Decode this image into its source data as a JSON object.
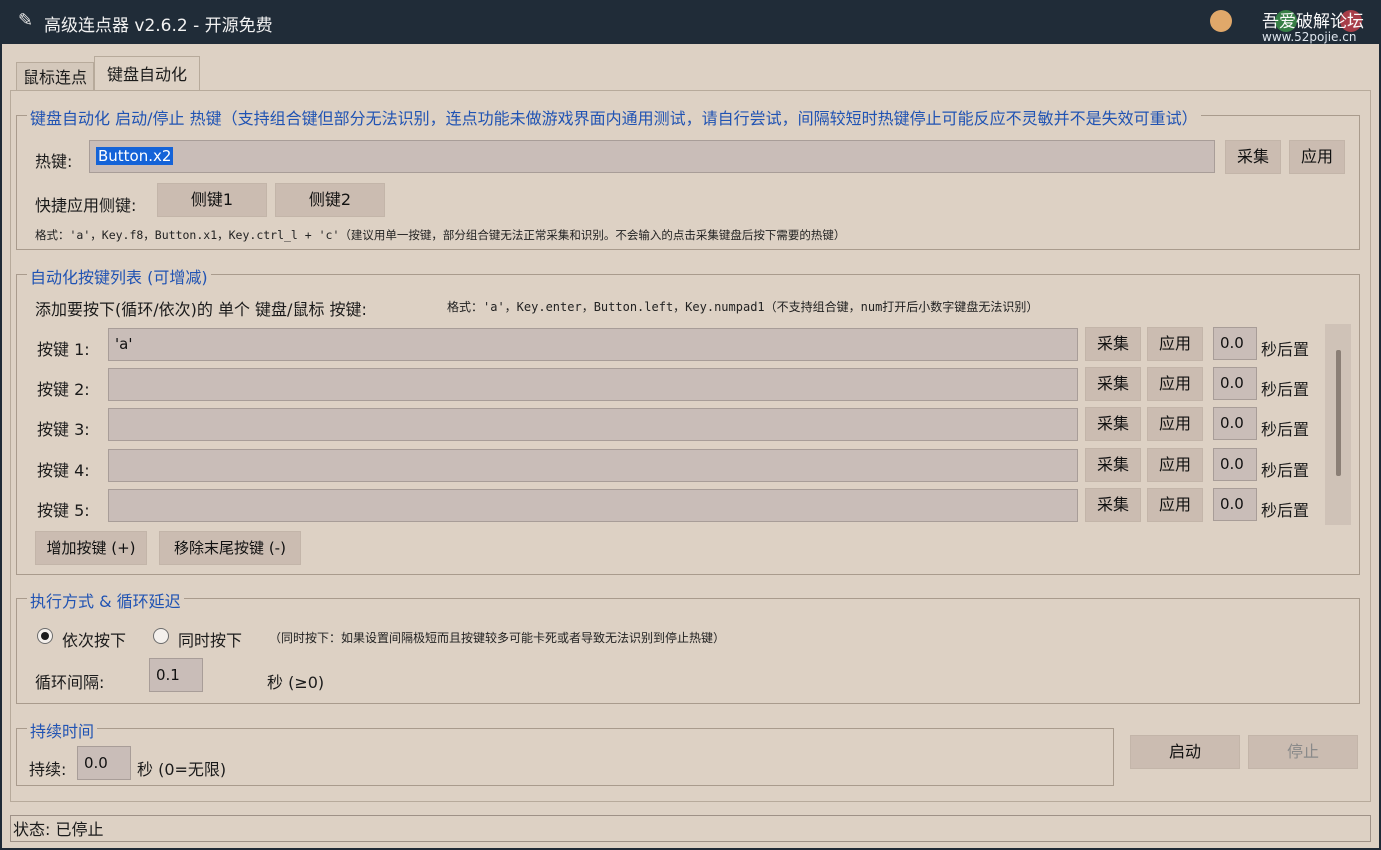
{
  "window": {
    "title": "高级连点器 v2.6.2 - 开源免费",
    "icon": "feather-icon",
    "watermark_line1": "吾爱破解论坛",
    "watermark_line2": "www.52pojie.cn"
  },
  "tabs": [
    {
      "label": "鼠标连点",
      "active": false
    },
    {
      "label": "键盘自动化",
      "active": true
    }
  ],
  "hotkey_group": {
    "legend": "键盘自动化 启动/停止 热键（支持组合键但部分无法识别，连点功能未做游戏界面内通用测试，请自行尝试，间隔较短时热键停止可能反应不灵敏并不是失效可重试）",
    "hotkey_label": "热键:",
    "hotkey_value": "Button.x2",
    "collect_label": "采集",
    "apply_label": "应用",
    "side_label": "快捷应用侧键:",
    "side1_label": "侧键1",
    "side2_label": "侧键2",
    "format_note": "格式：'a'，Key.f8，Button.x1，Key.ctrl_l + 'c'（建议用单一按键，部分组合键无法正常采集和识别。不会输入的点击采集键盘后按下需要的热键）"
  },
  "keys_group": {
    "legend": "自动化按键列表 (可增减)",
    "intro_label": "添加要按下(循环/依次)的 单个 键盘/鼠标 按键:",
    "intro_format": "格式：'a'，Key.enter，Button.left，Key.numpad1（不支持组合键，num打开后小数字键盘无法识别）",
    "rows": [
      {
        "label": "按键 1:",
        "value": "'a'",
        "collect": "采集",
        "apply": "应用",
        "delay": "0.0",
        "suffix": "秒后置"
      },
      {
        "label": "按键 2:",
        "value": "",
        "collect": "采集",
        "apply": "应用",
        "delay": "0.0",
        "suffix": "秒后置"
      },
      {
        "label": "按键 3:",
        "value": "",
        "collect": "采集",
        "apply": "应用",
        "delay": "0.0",
        "suffix": "秒后置"
      },
      {
        "label": "按键 4:",
        "value": "",
        "collect": "采集",
        "apply": "应用",
        "delay": "0.0",
        "suffix": "秒后置"
      },
      {
        "label": "按键 5:",
        "value": "",
        "collect": "采集",
        "apply": "应用",
        "delay": "0.0",
        "suffix": "秒后置"
      }
    ],
    "add_label": "增加按键 (+)",
    "remove_label": "移除末尾按键 (-)"
  },
  "mode_group": {
    "legend": "执行方式 & 循环延迟",
    "sequential_label": "依次按下",
    "simultaneous_label": "同时按下",
    "selected": "sequential",
    "note": "（同时按下：如果设置间隔极短而且按键较多可能卡死或者导致无法识别到停止热键）",
    "interval_label": "循环间隔:",
    "interval_value": "0.1",
    "interval_unit": "秒 (≥0)"
  },
  "duration_group": {
    "legend": "持续时间",
    "duration_label": "持续:",
    "duration_value": "0.0",
    "duration_unit": "秒 (0=无限)"
  },
  "actions": {
    "start_label": "启动",
    "stop_label": "停止",
    "stop_enabled": false
  },
  "status": {
    "text": "状态: 已停止"
  },
  "colors": {
    "titlebar": "#202c38",
    "background": "#ddd1c4",
    "legend_text": "#2053b3",
    "selection": "#1463d8"
  }
}
